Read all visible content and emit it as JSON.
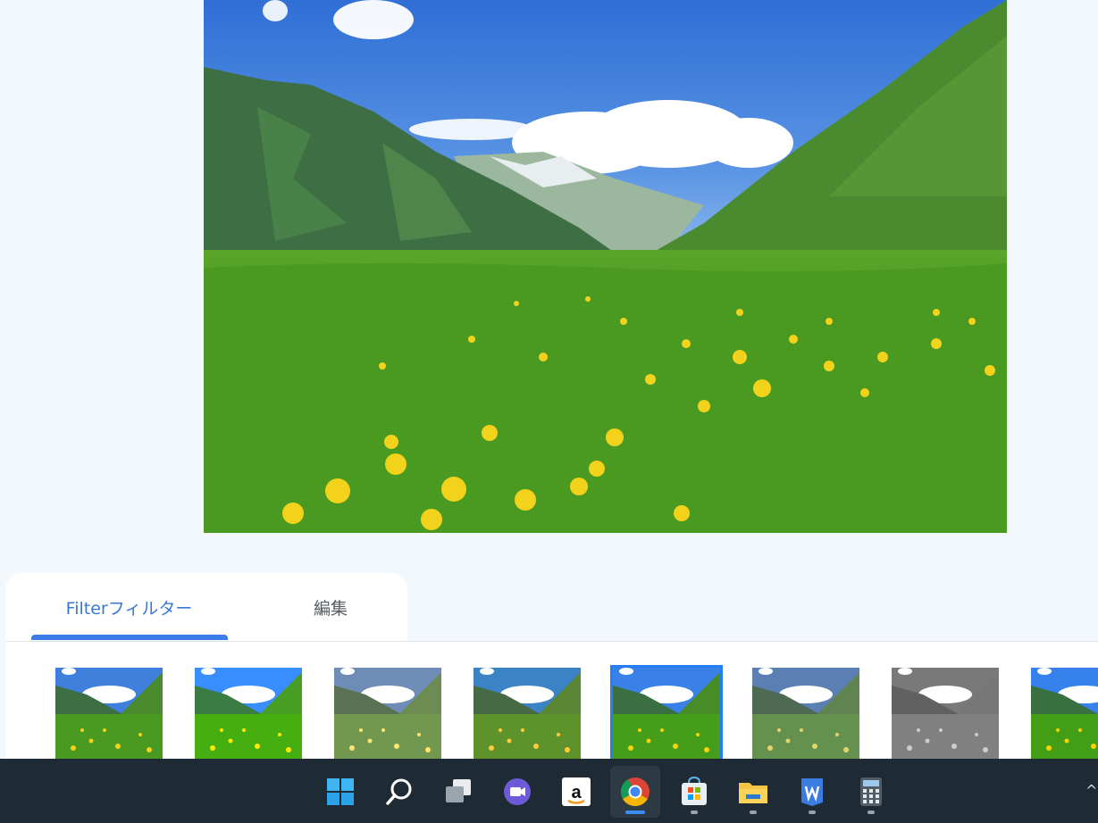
{
  "tabs": {
    "filter_label": "Filterフィルター",
    "edit_label": "編集",
    "active": "filter"
  },
  "filters": {
    "count": 8,
    "selected_index": 4,
    "styles": [
      "vivid",
      "bright",
      "warm-fade",
      "cool",
      "classic",
      "muted",
      "mono",
      "partial"
    ]
  },
  "taskbar": {
    "apps": [
      {
        "name": "start-icon"
      },
      {
        "name": "search-icon"
      },
      {
        "name": "task-view-icon"
      },
      {
        "name": "chat-icon"
      },
      {
        "name": "amazon-icon"
      },
      {
        "name": "chrome-icon",
        "active": true
      },
      {
        "name": "store-icon"
      },
      {
        "name": "file-explorer-icon"
      },
      {
        "name": "word-icon"
      },
      {
        "name": "calculator-icon"
      }
    ],
    "tray_chevron": "^"
  },
  "colors": {
    "accent": "#3b7ce8",
    "background": "#f3f8fd",
    "taskbar": "#1f2b34"
  }
}
